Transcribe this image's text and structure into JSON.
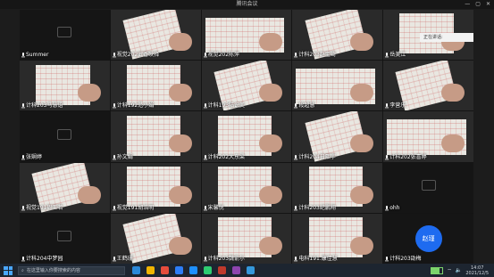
{
  "window": {
    "title": "腾讯会议",
    "controls": [
      "—",
      "▢",
      "✕"
    ]
  },
  "popup": {
    "text": "正在讲话:"
  },
  "tiles": [
    {
      "name": "Summer",
      "dark": true
    },
    {
      "name": "视觉202武香映择",
      "dark": false
    },
    {
      "name": "视觉202陈萍",
      "dark": false
    },
    {
      "name": "计科203赵宝琦",
      "dark": false
    },
    {
      "name": "岳美江",
      "dark": false
    },
    {
      "name": "计科203马慧语",
      "dark": false
    },
    {
      "name": "计科192范小娟",
      "dark": false
    },
    {
      "name": "计科193陆识美",
      "dark": false
    },
    {
      "name": "段超慧",
      "dark": false
    },
    {
      "name": "李营乐",
      "dark": false
    },
    {
      "name": "张娴婷",
      "dark": true
    },
    {
      "name": "孙文娟",
      "dark": false
    },
    {
      "name": "计科202大东梁",
      "dark": false
    },
    {
      "name": "计科204日熙宇",
      "dark": false
    },
    {
      "name": "计科202张喜婷",
      "dark": false
    },
    {
      "name": "视觉191周王若",
      "dark": false
    },
    {
      "name": "视觉191胡浩明",
      "dark": false
    },
    {
      "name": "宋馨悦",
      "dark": false
    },
    {
      "name": "计科203纪鹏翔",
      "dark": false
    },
    {
      "name": "ohh",
      "dark": true
    },
    {
      "name": "计科204中梦园",
      "dark": true
    },
    {
      "name": "王鹤珊",
      "dark": false
    },
    {
      "name": "计科203魏俞尔",
      "dark": false
    },
    {
      "name": "电科191.康佳慧",
      "dark": false
    },
    {
      "name": "计科203劭梅",
      "dark": true,
      "avatar": "赵瑾"
    }
  ],
  "taskbar": {
    "search_placeholder": "在这里输入你要搜索的内容",
    "time": "14:07",
    "date": "2021/12/5",
    "battery_level": 0.7,
    "app_colors": [
      "#2b88d8",
      "#f0b400",
      "#e74c3c",
      "#2d7df6",
      "#1e90ff",
      "#2ecc71",
      "#c0392b",
      "#8e44ad",
      "#3498db"
    ]
  }
}
